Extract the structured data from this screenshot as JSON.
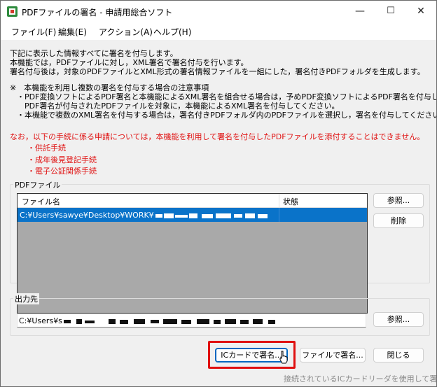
{
  "window": {
    "title": "PDFファイルの署名 - 申請用総合ソフト",
    "controls": {
      "minimize": "—",
      "maximize": "☐",
      "close": "✕"
    }
  },
  "menu": [
    "ファイル(F)",
    "編集(E)",
    "アクション(A)",
    "ヘルプ(H)"
  ],
  "intro": [
    "下記に表示した情報すべてに署名を付与します。",
    "本機能では，PDFファイルに対し，XML署名で署名付与を行います。",
    "署名付与後は，対象のPDFファイルとXML形式の署名情報ファイルを一組にした，署名付きPDFフォルダを生成します。"
  ],
  "notes": {
    "heading": "※　本機能を利用し複数の署名を付与する場合の注意事項",
    "bullets": [
      "・PDF変換ソフトによるPDF署名と本機能によるXML署名を組合せる場合は，予めPDF変換ソフトによるPDF署名を付与し，",
      "　PDF署名が付与されたPDFファイルを対象に，本機能によるXML署名を付与してください。",
      "・本機能で複数のXML署名を付与する場合は，署名付きPDFフォルダ内のPDFファイルを選択し，署名を付与してください。"
    ]
  },
  "warning": {
    "text": "なお，以下の手続に係る申請については，本機能を利用して署名を付与したPDFファイルを添付することはできません。",
    "items": [
      "・供託手続",
      "・成年後見登記手続",
      "・電子公証関係手続"
    ]
  },
  "pdf_group": {
    "label": "PDFファイル",
    "columns": [
      "ファイル名",
      "状態"
    ],
    "rows": [
      {
        "filename": "C:¥Users¥sawye¥Desktop¥WORK¥",
        "status": ""
      }
    ],
    "browse_button": "参照...",
    "delete_button": "削除"
  },
  "output_group": {
    "label": "出力先",
    "path": "C:¥Users¥s",
    "browse_button": "参照..."
  },
  "actions": {
    "ic_sign": "ICカードで署名...",
    "file_sign": "ファイルで署名...",
    "close": "閉じる"
  },
  "status_tooltip": "接続されているICカードリーダを使用して署名を"
}
